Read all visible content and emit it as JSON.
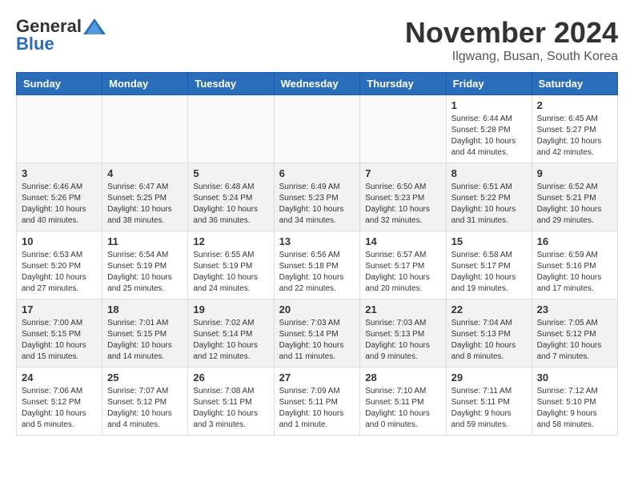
{
  "header": {
    "logo": {
      "general": "General",
      "blue": "Blue",
      "tagline": ""
    },
    "title": "November 2024",
    "location": "Ilgwang, Busan, South Korea"
  },
  "calendar": {
    "headers": [
      "Sunday",
      "Monday",
      "Tuesday",
      "Wednesday",
      "Thursday",
      "Friday",
      "Saturday"
    ],
    "weeks": [
      [
        {
          "day": "",
          "info": ""
        },
        {
          "day": "",
          "info": ""
        },
        {
          "day": "",
          "info": ""
        },
        {
          "day": "",
          "info": ""
        },
        {
          "day": "",
          "info": ""
        },
        {
          "day": "1",
          "info": "Sunrise: 6:44 AM\nSunset: 5:28 PM\nDaylight: 10 hours\nand 44 minutes."
        },
        {
          "day": "2",
          "info": "Sunrise: 6:45 AM\nSunset: 5:27 PM\nDaylight: 10 hours\nand 42 minutes."
        }
      ],
      [
        {
          "day": "3",
          "info": "Sunrise: 6:46 AM\nSunset: 5:26 PM\nDaylight: 10 hours\nand 40 minutes."
        },
        {
          "day": "4",
          "info": "Sunrise: 6:47 AM\nSunset: 5:25 PM\nDaylight: 10 hours\nand 38 minutes."
        },
        {
          "day": "5",
          "info": "Sunrise: 6:48 AM\nSunset: 5:24 PM\nDaylight: 10 hours\nand 36 minutes."
        },
        {
          "day": "6",
          "info": "Sunrise: 6:49 AM\nSunset: 5:23 PM\nDaylight: 10 hours\nand 34 minutes."
        },
        {
          "day": "7",
          "info": "Sunrise: 6:50 AM\nSunset: 5:23 PM\nDaylight: 10 hours\nand 32 minutes."
        },
        {
          "day": "8",
          "info": "Sunrise: 6:51 AM\nSunset: 5:22 PM\nDaylight: 10 hours\nand 31 minutes."
        },
        {
          "day": "9",
          "info": "Sunrise: 6:52 AM\nSunset: 5:21 PM\nDaylight: 10 hours\nand 29 minutes."
        }
      ],
      [
        {
          "day": "10",
          "info": "Sunrise: 6:53 AM\nSunset: 5:20 PM\nDaylight: 10 hours\nand 27 minutes."
        },
        {
          "day": "11",
          "info": "Sunrise: 6:54 AM\nSunset: 5:19 PM\nDaylight: 10 hours\nand 25 minutes."
        },
        {
          "day": "12",
          "info": "Sunrise: 6:55 AM\nSunset: 5:19 PM\nDaylight: 10 hours\nand 24 minutes."
        },
        {
          "day": "13",
          "info": "Sunrise: 6:56 AM\nSunset: 5:18 PM\nDaylight: 10 hours\nand 22 minutes."
        },
        {
          "day": "14",
          "info": "Sunrise: 6:57 AM\nSunset: 5:17 PM\nDaylight: 10 hours\nand 20 minutes."
        },
        {
          "day": "15",
          "info": "Sunrise: 6:58 AM\nSunset: 5:17 PM\nDaylight: 10 hours\nand 19 minutes."
        },
        {
          "day": "16",
          "info": "Sunrise: 6:59 AM\nSunset: 5:16 PM\nDaylight: 10 hours\nand 17 minutes."
        }
      ],
      [
        {
          "day": "17",
          "info": "Sunrise: 7:00 AM\nSunset: 5:15 PM\nDaylight: 10 hours\nand 15 minutes."
        },
        {
          "day": "18",
          "info": "Sunrise: 7:01 AM\nSunset: 5:15 PM\nDaylight: 10 hours\nand 14 minutes."
        },
        {
          "day": "19",
          "info": "Sunrise: 7:02 AM\nSunset: 5:14 PM\nDaylight: 10 hours\nand 12 minutes."
        },
        {
          "day": "20",
          "info": "Sunrise: 7:03 AM\nSunset: 5:14 PM\nDaylight: 10 hours\nand 11 minutes."
        },
        {
          "day": "21",
          "info": "Sunrise: 7:03 AM\nSunset: 5:13 PM\nDaylight: 10 hours\nand 9 minutes."
        },
        {
          "day": "22",
          "info": "Sunrise: 7:04 AM\nSunset: 5:13 PM\nDaylight: 10 hours\nand 8 minutes."
        },
        {
          "day": "23",
          "info": "Sunrise: 7:05 AM\nSunset: 5:12 PM\nDaylight: 10 hours\nand 7 minutes."
        }
      ],
      [
        {
          "day": "24",
          "info": "Sunrise: 7:06 AM\nSunset: 5:12 PM\nDaylight: 10 hours\nand 5 minutes."
        },
        {
          "day": "25",
          "info": "Sunrise: 7:07 AM\nSunset: 5:12 PM\nDaylight: 10 hours\nand 4 minutes."
        },
        {
          "day": "26",
          "info": "Sunrise: 7:08 AM\nSunset: 5:11 PM\nDaylight: 10 hours\nand 3 minutes."
        },
        {
          "day": "27",
          "info": "Sunrise: 7:09 AM\nSunset: 5:11 PM\nDaylight: 10 hours\nand 1 minute."
        },
        {
          "day": "28",
          "info": "Sunrise: 7:10 AM\nSunset: 5:11 PM\nDaylight: 10 hours\nand 0 minutes."
        },
        {
          "day": "29",
          "info": "Sunrise: 7:11 AM\nSunset: 5:11 PM\nDaylight: 9 hours\nand 59 minutes."
        },
        {
          "day": "30",
          "info": "Sunrise: 7:12 AM\nSunset: 5:10 PM\nDaylight: 9 hours\nand 58 minutes."
        }
      ]
    ]
  }
}
